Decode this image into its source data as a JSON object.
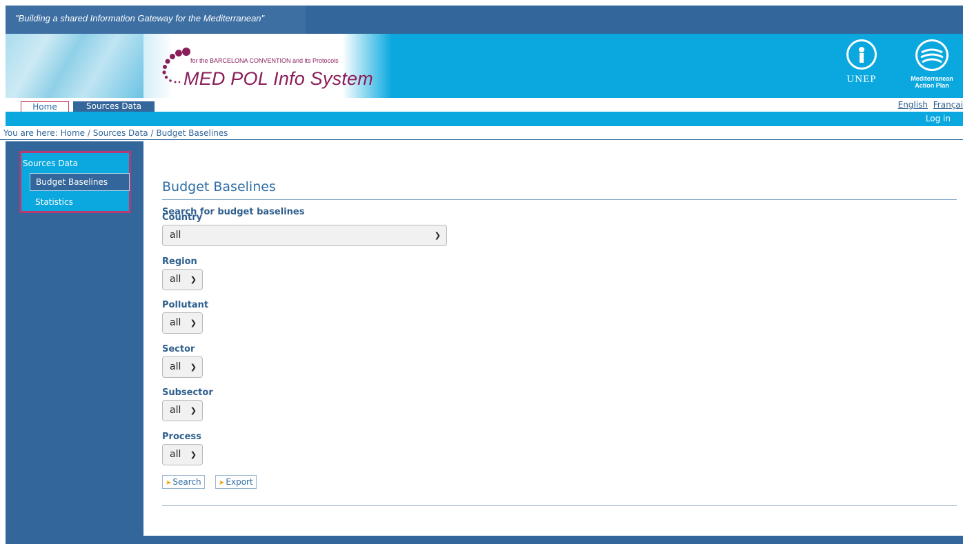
{
  "header": {
    "tagline": "\"Building a shared Information Gateway for the Mediterranean\"",
    "logo_subtitle": "for the BARCELONA CONVENTION and its Protocols",
    "logo_title": "MED POL Info System",
    "unep_label": "UNEP",
    "map_label_line1": "Mediterranean",
    "map_label_line2": "Action Plan"
  },
  "nav": {
    "tabs": [
      {
        "label": "Home"
      },
      {
        "label": "Sources Data"
      }
    ],
    "languages": [
      "English",
      "Françai"
    ],
    "login": "Log in"
  },
  "breadcrumb": "You are here: Home / Sources Data / Budget Baselines",
  "sidebar": {
    "title": "Sources Data",
    "items": [
      {
        "label": "Budget Baselines",
        "active": true
      },
      {
        "label": "Statistics",
        "active": false
      }
    ]
  },
  "main": {
    "title": "Budget Baselines",
    "subtitle": "Search for budget baselines",
    "fields": [
      {
        "label": "Country",
        "value": "all"
      },
      {
        "label": "Region",
        "value": "all"
      },
      {
        "label": "Pollutant",
        "value": "all"
      },
      {
        "label": "Sector",
        "value": "all"
      },
      {
        "label": "Subsector",
        "value": "all"
      },
      {
        "label": "Process",
        "value": "all"
      }
    ],
    "buttons": {
      "search": "Search",
      "export": "Export"
    }
  },
  "colors": {
    "primary_blue": "#33669a",
    "cyan": "#0aa8df",
    "brand_magenta": "#8a1e5a"
  }
}
